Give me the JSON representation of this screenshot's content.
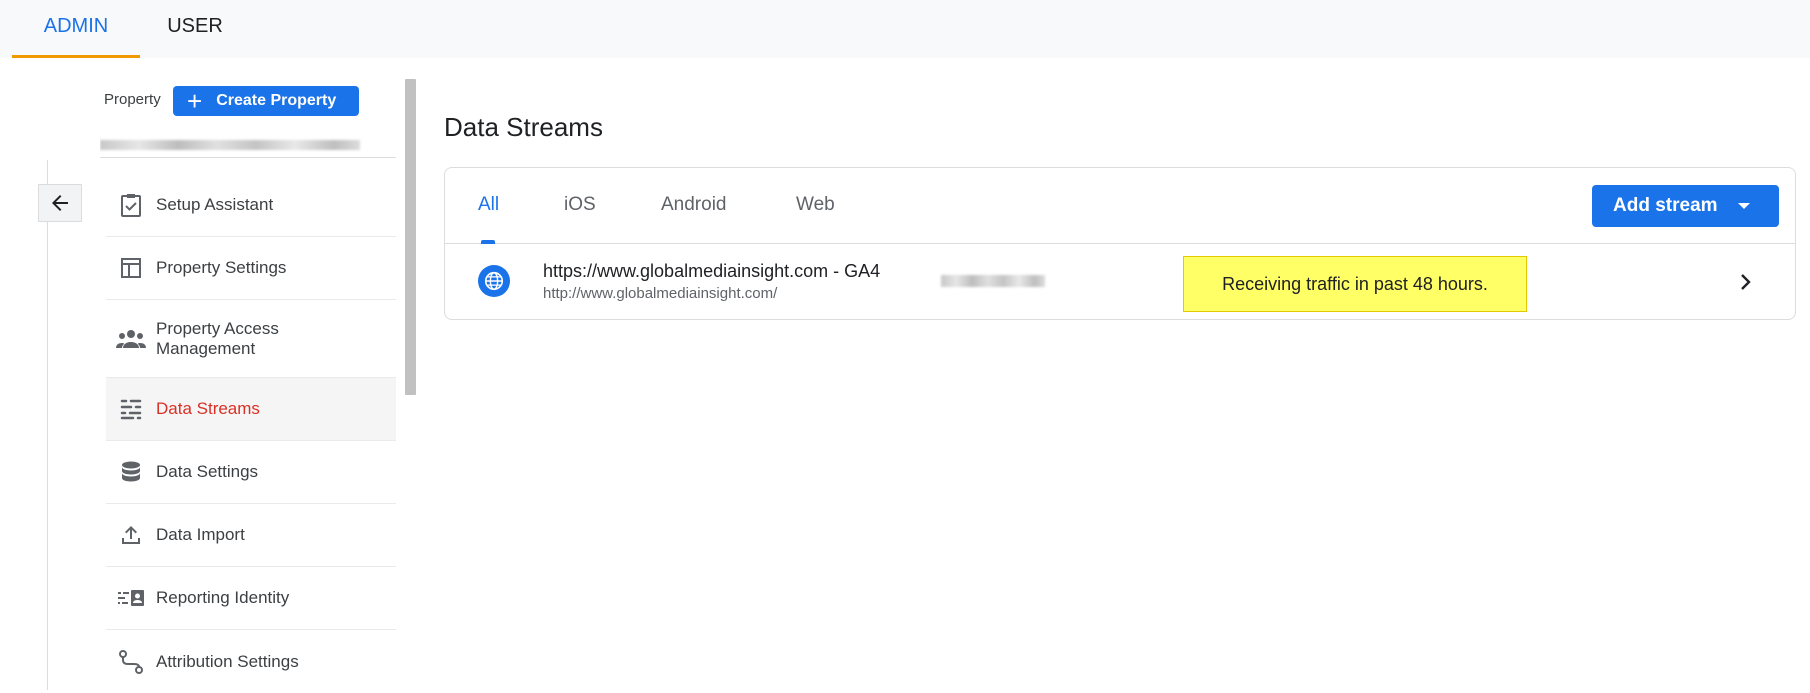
{
  "top_tabs": [
    {
      "label": "ADMIN",
      "active": true
    },
    {
      "label": "USER",
      "active": false
    }
  ],
  "sidebar": {
    "property_label": "Property",
    "create_property_label": "Create Property",
    "items": [
      {
        "label": "Setup Assistant",
        "icon": "clipboard-check-icon"
      },
      {
        "label": "Property Settings",
        "icon": "layout-icon"
      },
      {
        "label": "Property Access Management",
        "icon": "people-icon"
      },
      {
        "label": "Data Streams",
        "icon": "streams-icon",
        "active": true
      },
      {
        "label": "Data Settings",
        "icon": "database-icon"
      },
      {
        "label": "Data Import",
        "icon": "upload-icon"
      },
      {
        "label": "Reporting Identity",
        "icon": "reporting-identity-icon"
      },
      {
        "label": "Attribution Settings",
        "icon": "attribution-icon"
      }
    ]
  },
  "main": {
    "title": "Data Streams",
    "tabs": [
      {
        "label": "All",
        "active": true
      },
      {
        "label": "iOS"
      },
      {
        "label": "Android"
      },
      {
        "label": "Web"
      }
    ],
    "add_stream_label": "Add stream",
    "streams": [
      {
        "name": "https://www.globalmediainsight.com - GA4",
        "url": "http://www.globalmediainsight.com/",
        "icon": "globe-icon",
        "status": "Receiving traffic in past 48 hours."
      }
    ]
  },
  "colors": {
    "accent": "#1a73e8",
    "active_nav": "#d93025",
    "tab_underline": "#f29900",
    "status_highlight": "#ffff66"
  }
}
